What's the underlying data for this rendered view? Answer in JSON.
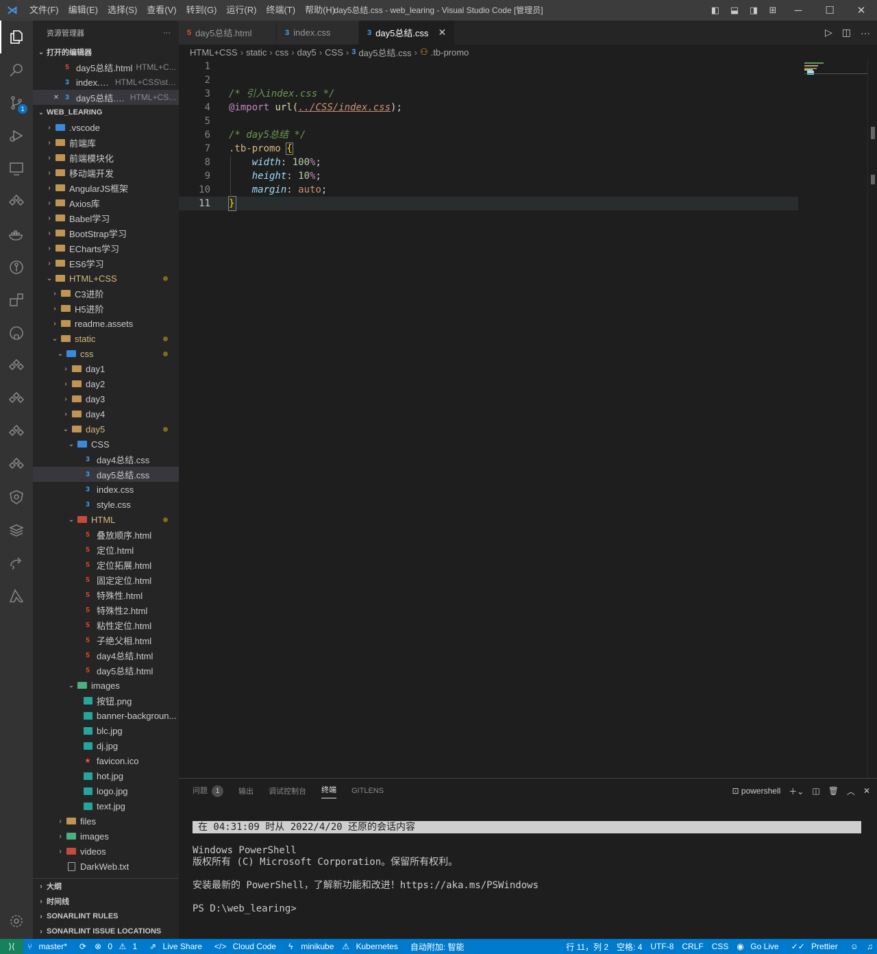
{
  "titlebar": {
    "menu": [
      "文件(F)",
      "编辑(E)",
      "选择(S)",
      "查看(V)",
      "转到(G)",
      "运行(R)",
      "终端(T)",
      "帮助(H)"
    ],
    "title": "day5总结.css - web_learing - Visual Studio Code [管理员]"
  },
  "activity": {
    "scm_badge": "1"
  },
  "sidebar": {
    "title": "资源管理器",
    "more": "···",
    "open_editors_title": "打开的编辑器",
    "open_editors": [
      {
        "name": "day5总结.html",
        "desc": "HTML+C..."
      },
      {
        "name": "index.css",
        "desc": "HTML+CSS\\stat..."
      },
      {
        "name": "day5总结.css",
        "desc": "HTML+CSS..."
      }
    ],
    "workspace_title": "WEB_LEARING",
    "tree": [
      ".vscode",
      "前端库",
      "前端模块化",
      "移动端开发",
      "AngularJS框架",
      "Axios库",
      "Babel学习",
      "BootStrap学习",
      "ECharts学习",
      "ES6学习",
      "HTML+CSS",
      "C3进阶",
      "H5进阶",
      "readme.assets",
      "static",
      "css",
      "day1",
      "day2",
      "day3",
      "day4",
      "day5",
      "CSS",
      "day4总结.css",
      "day5总结.css",
      "index.css",
      "style.css",
      "HTML",
      "叠放顺序.html",
      "定位.html",
      "定位拓展.html",
      "固定定位.html",
      "特殊性.html",
      "特殊性2.html",
      "粘性定位.html",
      "子绝父相.html",
      "day4总结.html",
      "day5总结.html",
      "images",
      "按钮.png",
      "banner-backgroun...",
      "blc.jpg",
      "dj.jpg",
      "favicon.ico",
      "hot.jpg",
      "logo.jpg",
      "text.jpg",
      "files",
      "images",
      "videos",
      "DarkWeb.txt"
    ],
    "bottom_sections": [
      "大纲",
      "时间线",
      "SONARLINT RULES",
      "SONARLINT ISSUE LOCATIONS"
    ]
  },
  "tabs": [
    {
      "label": "day5总结.html",
      "icon": "html-5-icon"
    },
    {
      "label": "index.css",
      "icon": "css-3-icon"
    },
    {
      "label": "day5总结.css",
      "icon": "css-3-icon",
      "close": "✕"
    }
  ],
  "breadcrumbs": [
    "HTML+CSS",
    "static",
    "css",
    "day5",
    "CSS",
    "day5总结.css",
    ".tb-promo"
  ],
  "editor": {
    "line_numbers": [
      "1",
      "2",
      "3",
      "4",
      "5",
      "6",
      "7",
      "8",
      "9",
      "10",
      "11"
    ],
    "code": {
      "l3": "/* 引入index.css */",
      "l4_at": "@import",
      "l4_fn": "url(",
      "l4_str": "../CSS/index.css",
      "l4_end": ");",
      "l6": "/* day5总结 */",
      "l7_sel": ".tb-promo",
      "l7_br": "{",
      "l8_prop": "width",
      "l8_num": "100",
      "l8_unit": "%",
      "l9_prop": "height",
      "l9_num": "10",
      "l9_unit": "%",
      "l10_prop": "margin",
      "l10_val": "auto",
      "l11_br": "}"
    }
  },
  "panel": {
    "tabs": [
      "问题",
      "输出",
      "调试控制台",
      "终端",
      "GITLENS"
    ],
    "problems_count": "1",
    "shell": "powershell",
    "terminal": {
      "restored": "在  04:31:09 时从 2022/4/20 还原的会话内容",
      "l1": "Windows PowerShell",
      "l2": "版权所有 (C)  Microsoft Corporation。保留所有权利。",
      "l3": "安装最新的 PowerShell，了解新功能和改进！https://aka.ms/PSWindows",
      "l4": "PS D:\\web_learing>"
    }
  },
  "status": {
    "branch": "master*",
    "errors": "0",
    "warnings": "1",
    "left": [
      "Live Share",
      "Cloud Code",
      "minikube",
      "Kubernetes",
      "自动附加: 智能"
    ],
    "position": "行 11，列 2",
    "spaces": "空格: 4",
    "encoding": "UTF-8",
    "eol": "CRLF",
    "language": "CSS",
    "golive": "Go Live",
    "prettier": "Prettier"
  },
  "colors": {
    "accent": "#007acc",
    "activity_bg": "#333333",
    "sidebar_bg": "#252526",
    "editor_bg": "#1e1e1e"
  }
}
